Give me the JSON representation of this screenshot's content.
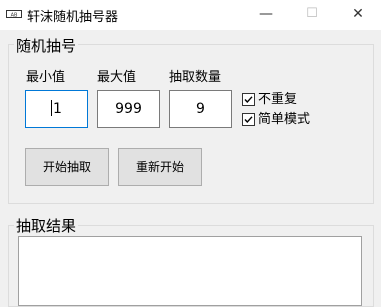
{
  "window": {
    "title": "轩沫随机抽号器",
    "minimize_glyph": "—",
    "maximize_glyph": "☐",
    "close_glyph": "✕"
  },
  "random_group": {
    "title": "随机抽号",
    "min_label": "最小值",
    "max_label": "最大值",
    "count_label": "抽取数量",
    "min_value": "1",
    "max_value": "999",
    "count_value": "9",
    "no_repeat_label": "不重复",
    "no_repeat_checked": true,
    "simple_mode_label": "简单模式",
    "simple_mode_checked": true,
    "start_button": "开始抽取",
    "restart_button": "重新开始"
  },
  "result_group": {
    "title": "抽取结果",
    "content": ""
  },
  "icons": {
    "app": "app-icon",
    "check": "checkmark-icon"
  }
}
